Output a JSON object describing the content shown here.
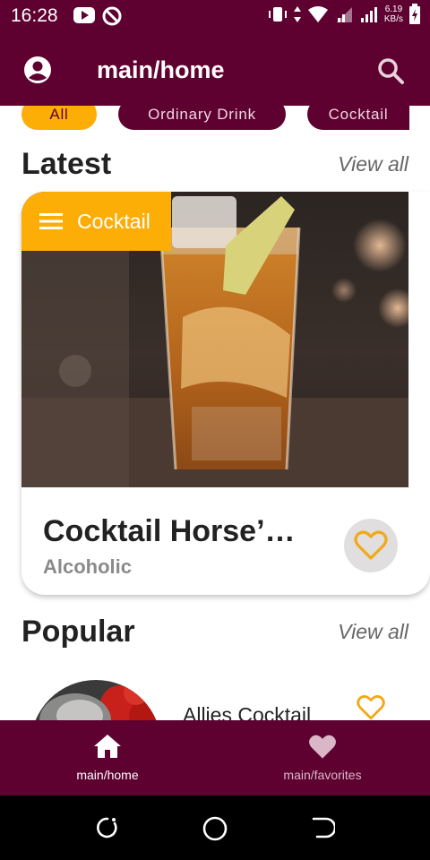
{
  "status_bar": {
    "time": "16:28",
    "net_speed_value": "6.19",
    "net_speed_unit": "KB/s",
    "icons": [
      "youtube-icon",
      "vpn-icon",
      "vibrate-icon",
      "data-arrows-icon",
      "wifi-icon",
      "signal-icon",
      "signal-icon",
      "battery-icon"
    ]
  },
  "app_bar": {
    "title": "main/home",
    "left_icon": "account-circle-icon",
    "right_icon": "search-icon"
  },
  "categories": [
    "All",
    "Ordinary Drink",
    "Cocktail"
  ],
  "latest": {
    "title": "Latest",
    "view_all": "View all",
    "card": {
      "category": "Cocktail",
      "name": "Cocktail Horse’…",
      "alcoholic": "Alcoholic",
      "favorite_icon": "heart-outline-icon"
    }
  },
  "popular": {
    "title": "Popular",
    "view_all": "View all",
    "items": [
      {
        "name": "Allies Cocktail",
        "favorite_icon": "heart-outline-icon"
      }
    ]
  },
  "bottom_nav": {
    "items": [
      {
        "label": "main/home",
        "icon": "home-icon",
        "active": true
      },
      {
        "label": "main/favorites",
        "icon": "heart-icon",
        "active": false
      }
    ]
  },
  "system_nav": {
    "icons": [
      "recents-icon",
      "home-circle-icon",
      "back-icon"
    ]
  },
  "colors": {
    "primary": "#5e0130",
    "accent": "#fcad06",
    "text_dark": "#222222",
    "text_muted": "#8a8a8a"
  }
}
